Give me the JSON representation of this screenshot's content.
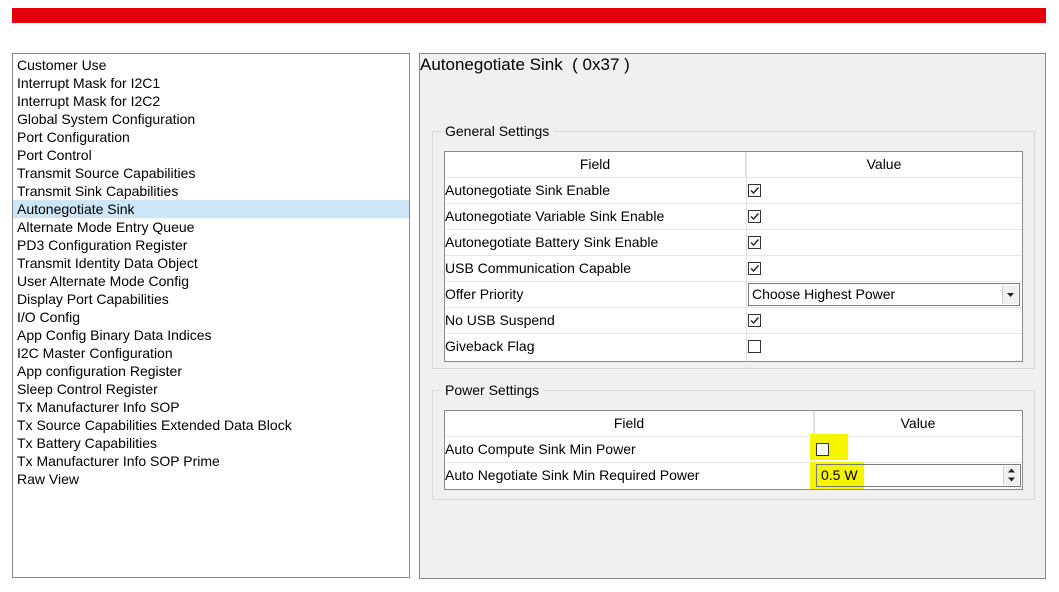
{
  "nav": {
    "items": [
      "Customer Use",
      "Interrupt Mask for I2C1",
      "Interrupt Mask for I2C2",
      "Global System Configuration",
      "Port Configuration",
      "Port Control",
      "Transmit Source Capabilities",
      "Transmit Sink Capabilities",
      "Autonegotiate Sink",
      "Alternate Mode Entry Queue",
      "PD3 Configuration Register",
      "Transmit Identity Data Object",
      "User Alternate Mode Config",
      "Display Port Capabilities",
      "I/O Config",
      "App Config Binary Data Indices",
      "I2C Master Configuration",
      "App configuration Register",
      "Sleep Control Register",
      "Tx Manufacturer Info SOP",
      "Tx Source Capabilities Extended Data Block",
      "Tx Battery Capabilities",
      "Tx Manufacturer Info SOP Prime",
      "Raw View"
    ],
    "selected": "Autonegotiate Sink"
  },
  "panel": {
    "title": "Autonegotiate Sink  ( 0x37 )",
    "general": {
      "label": "General Settings",
      "col_field": "Field",
      "col_value": "Value",
      "rows": [
        {
          "field": "Autonegotiate Sink Enable",
          "type": "checkbox",
          "checked": true
        },
        {
          "field": "Autonegotiate Variable Sink Enable",
          "type": "checkbox",
          "checked": true
        },
        {
          "field": "Autonegotiate Battery Sink Enable",
          "type": "checkbox",
          "checked": true
        },
        {
          "field": "USB Communication Capable",
          "type": "checkbox",
          "checked": true
        },
        {
          "field": "Offer Priority",
          "type": "select",
          "value": "Choose Highest Power"
        },
        {
          "field": "No USB Suspend",
          "type": "checkbox",
          "checked": true
        },
        {
          "field": "Giveback Flag",
          "type": "checkbox",
          "checked": false
        }
      ]
    },
    "power": {
      "label": "Power Settings",
      "col_field": "Field",
      "col_value": "Value",
      "rows": [
        {
          "field": "Auto Compute Sink Min Power",
          "type": "checkbox",
          "checked": false
        },
        {
          "field": "Auto Negotiate Sink Min Required Power",
          "type": "spin",
          "value": "0.5 W"
        }
      ]
    }
  },
  "colors": {
    "brand_bar": "#e3000b",
    "selection": "#cde6f7",
    "highlight": "#f5f500"
  }
}
